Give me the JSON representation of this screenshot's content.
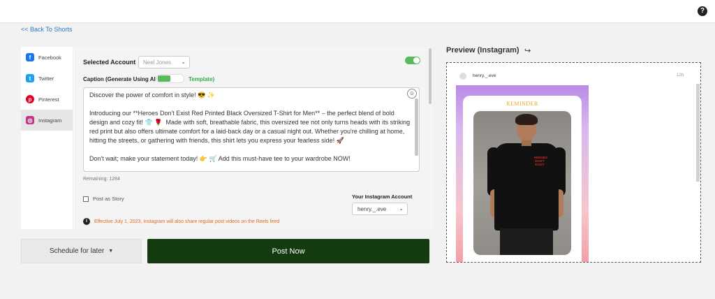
{
  "header": {
    "help_icon": "help-circle-icon",
    "help_glyph": "?"
  },
  "back_link": "<< Back To Shorts",
  "sidebar": {
    "items": [
      {
        "label": "Facebook",
        "icon": "facebook-icon",
        "glyph": "f",
        "color": "#1877f2"
      },
      {
        "label": "Twitter",
        "icon": "twitter-icon",
        "glyph": "t",
        "color": "#1da1f2"
      },
      {
        "label": "Pinterest",
        "icon": "pinterest-icon",
        "glyph": "p",
        "color": "#e60023"
      },
      {
        "label": "Instagram",
        "icon": "instagram-icon",
        "glyph": "◎",
        "color": "#c13584",
        "active": true
      }
    ]
  },
  "form": {
    "selected_account_label": "Selected Account",
    "selected_account_value": "Neel Jones",
    "caption_label": "Caption (Generate Using AI",
    "template_link": "Template)",
    "caption_text": "Discover the power of comfort in style! 😎 ✨\n\nIntroducing our **Heroes Don't Exist Red Printed Black Oversized T-Shirt for Men** – the perfect blend of bold design and cozy fit! 👕 🌹  Made with soft, breathable fabric, this oversized tee not only turns heads with its striking red print but also offers ultimate comfort for a laid-back day or a casual night out. Whether you're chilling at home, hitting the streets, or gathering with friends, this shirt lets you express your fearless side! 🚀\n\nDon't wait; make your statement today! 👉 🛒 Add this must-have tee to your wardrobe NOW!",
    "remaining": "Remaining: 1284",
    "post_as_story": "Post as Story",
    "instagram_account_label": "Your Instagram Account",
    "instagram_account_value": "henry._.eve",
    "notice": "Effective July 1, 2023, Instagram will also share regular post videos on the Reels feed",
    "colors": {
      "toggle_on": "#5cb85c",
      "notice": "#e06a1b"
    }
  },
  "actions": {
    "schedule_label": "Schedule for later",
    "post_now_label": "Post Now",
    "post_color": "#143a10"
  },
  "preview": {
    "title": "Preview (Instagram)",
    "username": "henry._.eve",
    "time": "12h",
    "post_image": {
      "banner": "REMINDER",
      "print_text": "HEROES DON'T EXIST"
    }
  }
}
